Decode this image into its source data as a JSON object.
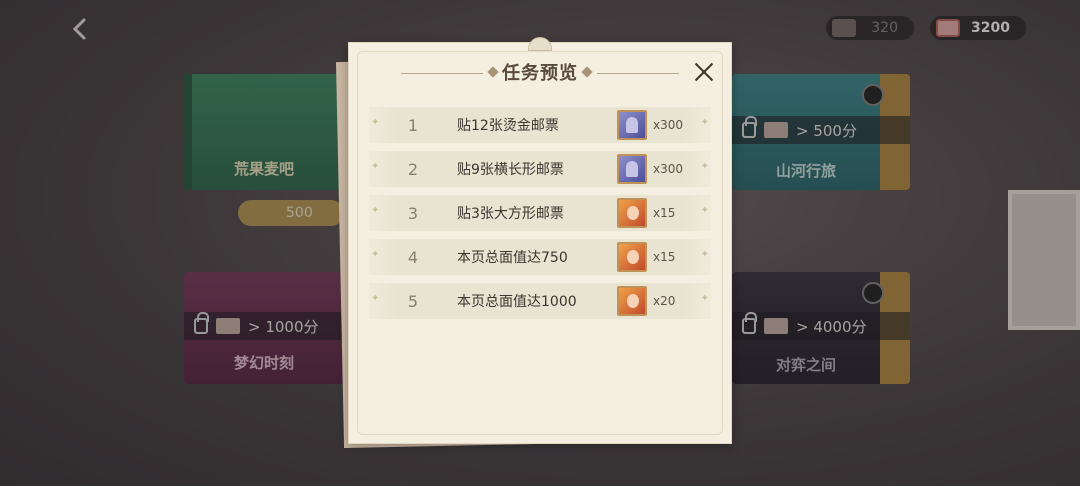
{
  "topbar": {
    "currency_1": "320",
    "currency_2": "3200"
  },
  "background_cards": {
    "card1_title": "荒果麦吧",
    "card1_price": "500",
    "card2_requirement": "> 500分",
    "card2_title": "山河行旅",
    "card3_requirement": "> 1000分",
    "card3_title": "梦幻时刻",
    "card4_requirement": "> 4000分",
    "card4_title": "对弈之间"
  },
  "modal": {
    "title": "任务预览",
    "tasks": [
      {
        "num": "1",
        "desc": "贴12张烫金邮票",
        "reward_icon": "stamp-item-icon",
        "qty": "x300"
      },
      {
        "num": "2",
        "desc": "贴9张横长形邮票",
        "reward_icon": "stamp-item-icon",
        "qty": "x300"
      },
      {
        "num": "3",
        "desc": "贴3张大方形邮票",
        "reward_icon": "hero-portrait-icon",
        "qty": "x15"
      },
      {
        "num": "4",
        "desc": "本页总面值达750",
        "reward_icon": "hero-portrait-icon",
        "qty": "x15"
      },
      {
        "num": "5",
        "desc": "本页总面值达1000",
        "reward_icon": "hero-portrait-icon",
        "qty": "x20"
      }
    ]
  }
}
